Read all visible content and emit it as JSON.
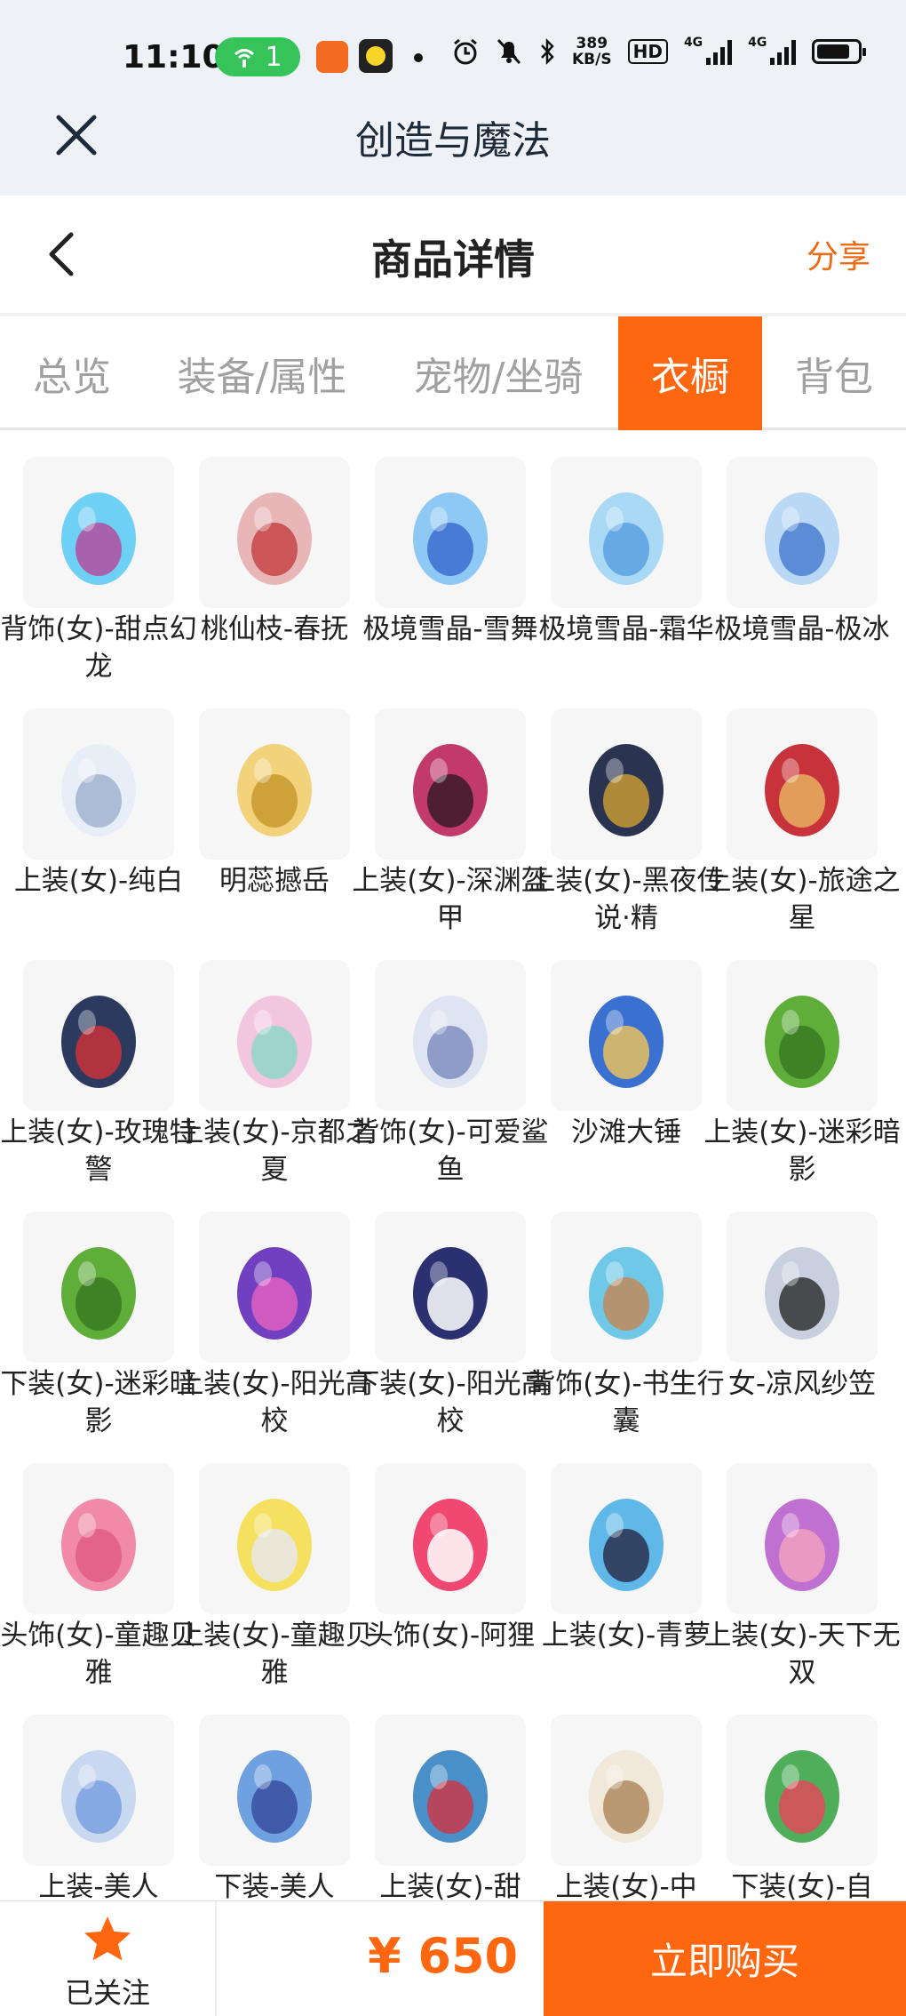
{
  "status_bar": {
    "time": "11:10",
    "hotspot_count": "1",
    "net_speed_value": "389",
    "net_speed_unit": "KB/S",
    "hd_label": "HD",
    "net_type_1": "4G",
    "net_type_2": "4G"
  },
  "app_bar": {
    "title": "创造与魔法"
  },
  "header": {
    "title": "商品详情",
    "share_label": "分享"
  },
  "tabs": [
    {
      "label": "总览",
      "active": false
    },
    {
      "label": "装备/属性",
      "active": false
    },
    {
      "label": "宠物/坐骑",
      "active": false
    },
    {
      "label": "衣橱",
      "active": true
    },
    {
      "label": "背包",
      "active": false
    }
  ],
  "items": [
    {
      "name": "背饰(女)-甜点幻龙",
      "icon": "dragon-pet-icon"
    },
    {
      "name": "桃仙枝-春抚",
      "icon": "peach-branch-weapon-icon"
    },
    {
      "name": "极境雪晶-雪舞",
      "icon": "ice-scythe-icon"
    },
    {
      "name": "极境雪晶-霜华",
      "icon": "ice-crossbow-icon"
    },
    {
      "name": "极境雪晶-极冰",
      "icon": "ice-bow-icon"
    },
    {
      "name": "上装(女)-纯白",
      "icon": "white-dress-icon"
    },
    {
      "name": "明蕊撼岳",
      "icon": "golden-spear-icon"
    },
    {
      "name": "上装(女)-深渊盔甲",
      "icon": "abyss-armor-icon"
    },
    {
      "name": "上装(女)-黑夜传说·精",
      "icon": "night-legend-armor-icon"
    },
    {
      "name": "上装(女)-旅途之星",
      "icon": "red-outfit-icon"
    },
    {
      "name": "上装(女)-玫瑰特警",
      "icon": "police-uniform-icon"
    },
    {
      "name": "上装(女)-京都之夏",
      "icon": "kimono-icon"
    },
    {
      "name": "背饰(女)-可爱鲨鱼",
      "icon": "shark-backpack-icon"
    },
    {
      "name": "沙滩大锤",
      "icon": "beach-hammer-icon"
    },
    {
      "name": "上装(女)-迷彩暗影",
      "icon": "ghillie-top-icon"
    },
    {
      "name": "下装(女)-迷彩暗影",
      "icon": "ghillie-pants-icon"
    },
    {
      "name": "上装(女)-阳光高校",
      "icon": "school-jacket-icon"
    },
    {
      "name": "下装(女)-阳光高校",
      "icon": "school-boots-icon"
    },
    {
      "name": "背饰(女)-书生行囊",
      "icon": "scholar-pack-icon"
    },
    {
      "name": "女-凉风纱笠",
      "icon": "veiled-hat-icon"
    },
    {
      "name": "头饰(女)-童趣贝雅",
      "icon": "pink-hair-icon"
    },
    {
      "name": "上装(女)-童趣贝雅",
      "icon": "yellow-dress-icon"
    },
    {
      "name": "头饰(女)-阿狸",
      "icon": "fox-head-icon"
    },
    {
      "name": "上装(女)-青萝",
      "icon": "blue-dress-icon"
    },
    {
      "name": "上装(女)-天下无双",
      "icon": "purple-dress-icon"
    },
    {
      "name": "上装-美人",
      "icon": "mermaid-top-icon"
    },
    {
      "name": "下装-美人",
      "icon": "mermaid-tail-icon"
    },
    {
      "name": "上装(女)-甜",
      "icon": "blue-coat-icon"
    },
    {
      "name": "上装(女)-中",
      "icon": "white-blouse-icon"
    },
    {
      "name": "下装(女)-自",
      "icon": "tribal-skirt-icon"
    }
  ],
  "bottom_bar": {
    "follow_label": "已关注",
    "price": "¥ 650",
    "buy_label": "立即购买",
    "accent_color": "#ff6610"
  }
}
